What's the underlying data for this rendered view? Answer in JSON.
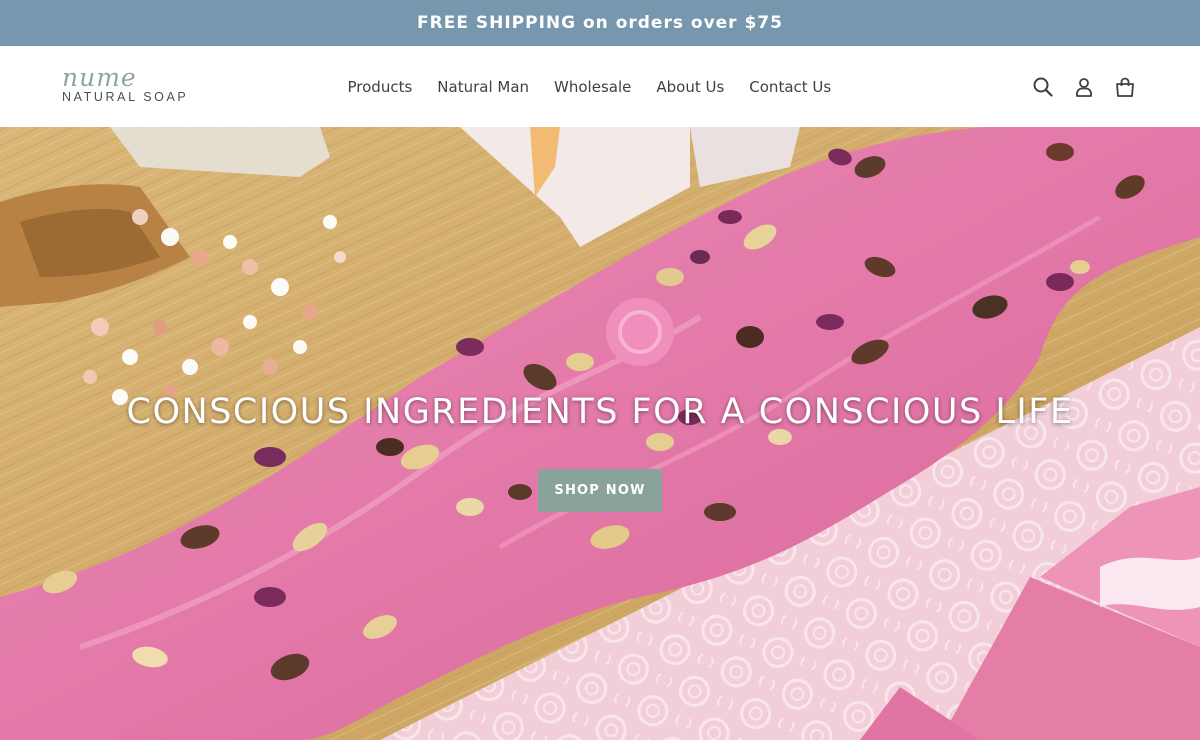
{
  "announcement": {
    "text": "FREE SHIPPING on orders over $75"
  },
  "brand": {
    "script": "nume",
    "sub": "NATURAL SOAP"
  },
  "nav": {
    "items": [
      {
        "label": "Products"
      },
      {
        "label": "Natural Man"
      },
      {
        "label": "Wholesale"
      },
      {
        "label": "About Us"
      },
      {
        "label": "Contact Us"
      }
    ]
  },
  "icons": {
    "search": "search-icon",
    "account": "account-icon",
    "cart": "cart-icon"
  },
  "hero": {
    "title": "CONSCIOUS INGREDIENTS FOR A CONSCIOUS LIFE",
    "button_label": "SHOP NOW"
  },
  "colors": {
    "announcement_bg": "#7697ad",
    "button_bg": "#8aa39a",
    "logo_script": "#8fa59c",
    "soap_pink": "#e27aa8"
  }
}
